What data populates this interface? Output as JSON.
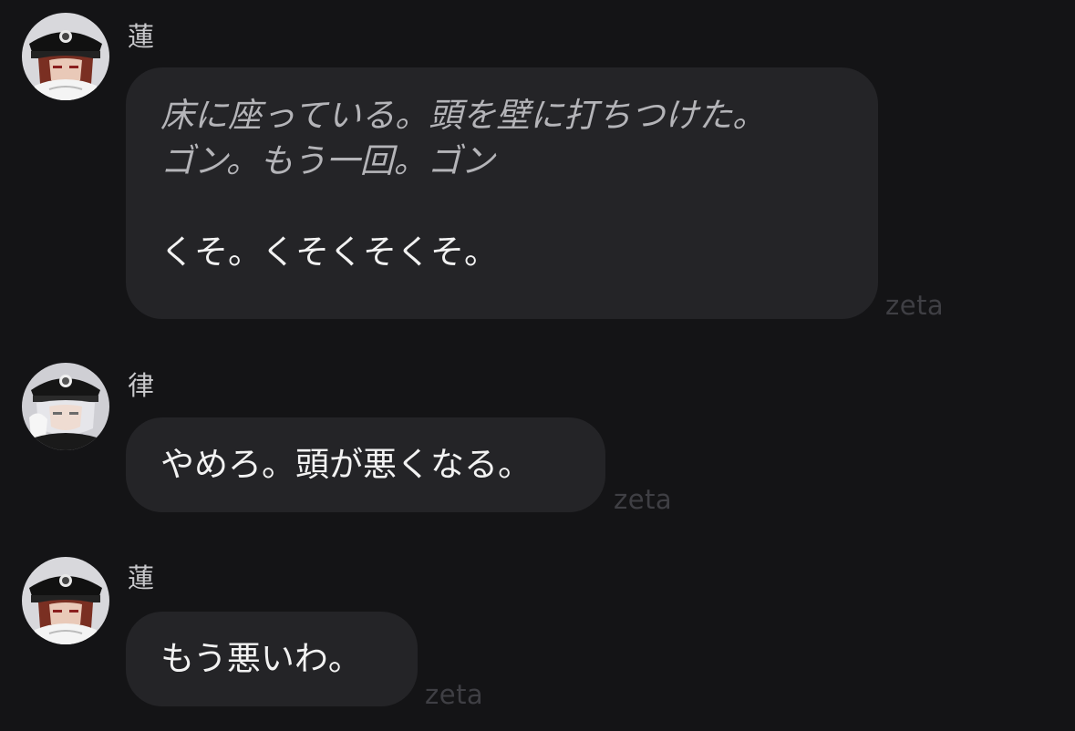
{
  "messages": [
    {
      "sender": "蓮",
      "avatar": "ren-avatar",
      "action_lines": [
        "床に座っている。頭を壁に打ちつけた。",
        "ゴン。もう一回。ゴン"
      ],
      "speech": "くそ。くそくそくそ。",
      "footer": "zeta"
    },
    {
      "sender": "律",
      "avatar": "ritsu-avatar",
      "speech": "やめろ。頭が悪くなる。",
      "footer": "zeta"
    },
    {
      "sender": "蓮",
      "avatar": "ren-avatar",
      "speech": "もう悪いわ。",
      "footer": "zeta"
    }
  ],
  "colors": {
    "background": "#141416",
    "bubble": "#242427",
    "action_text": "#b4b4b8",
    "speech_text": "#f2f2f2",
    "footer_text": "#3f3f44"
  }
}
